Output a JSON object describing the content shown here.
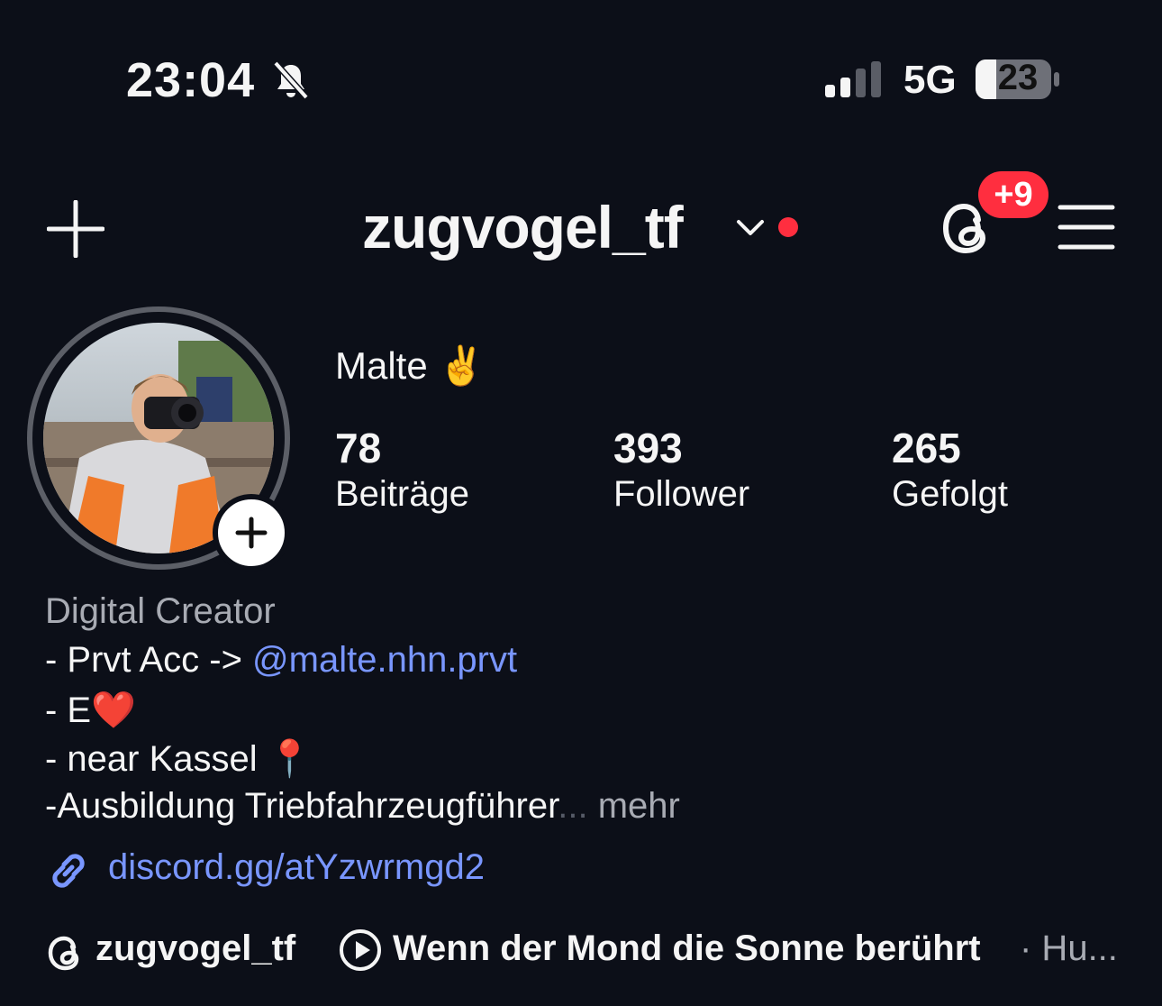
{
  "status_bar": {
    "time": "23:04",
    "network": "5G",
    "battery": "23"
  },
  "header": {
    "username": "zugvogel_tf",
    "threads_badge": "+9"
  },
  "profile": {
    "name": "Malte ✌️",
    "stats": [
      {
        "value": "78",
        "label": "Beiträge"
      },
      {
        "value": "393",
        "label": "Follower"
      },
      {
        "value": "265",
        "label": "Gefolgt"
      }
    ]
  },
  "bio": {
    "category": "Digital Creator",
    "line1_prefix": "- Prvt Acc -> ",
    "line1_mention": "@malte.nhn.prvt",
    "line2": "- E❤️",
    "line3": "- near Kassel 📍",
    "line4": "-Ausbildung Triebfahrzeugführer",
    "ellipsis": "...",
    "more": " mehr",
    "link": "discord.gg/atYzwrmgd2"
  },
  "bottom": {
    "threads_user": "zugvogel_tf",
    "song": "Wenn der Mond die Sonne berührt",
    "artist": "· Hu..."
  },
  "colors": {
    "background": "#0c0f18",
    "accent_link": "#7996ff",
    "badge_red": "#ff2e3f"
  }
}
